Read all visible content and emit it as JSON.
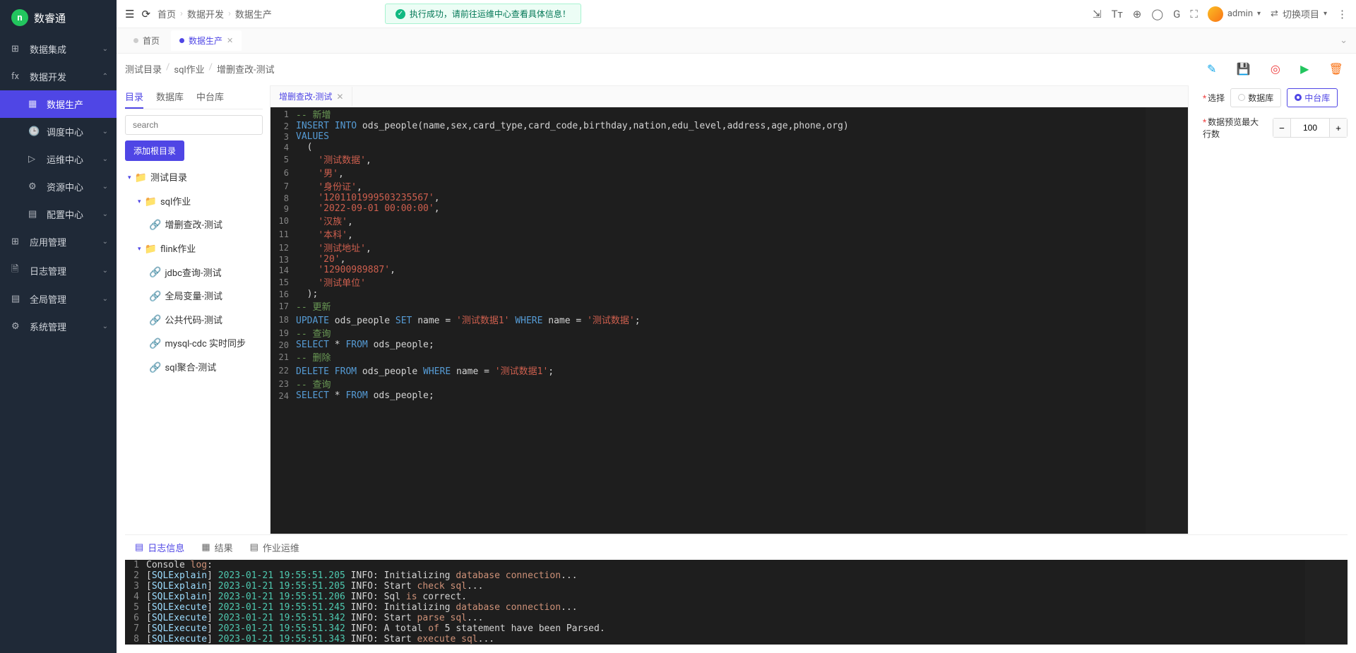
{
  "app": {
    "name": "数睿通",
    "logo_text": "n"
  },
  "sidebar": {
    "items": [
      {
        "icon": "⊞",
        "label": "数据集成",
        "chev": "⌄"
      },
      {
        "icon": "fx",
        "label": "数据开发",
        "chev": "⌃",
        "expanded": true,
        "children": [
          {
            "icon": "▦",
            "label": "数据生产",
            "active": true
          },
          {
            "icon": "🕒",
            "label": "调度中心",
            "chev": "⌄"
          },
          {
            "icon": "▷",
            "label": "运维中心",
            "chev": "⌄"
          },
          {
            "icon": "⚙",
            "label": "资源中心",
            "chev": "⌄"
          },
          {
            "icon": "▤",
            "label": "配置中心",
            "chev": "⌄"
          }
        ]
      },
      {
        "icon": "⊞",
        "label": "应用管理",
        "chev": "⌄"
      },
      {
        "icon": "🗎",
        "label": "日志管理",
        "chev": "⌄"
      },
      {
        "icon": "▤",
        "label": "全局管理",
        "chev": "⌄"
      },
      {
        "icon": "⚙",
        "label": "系统管理",
        "chev": "⌄"
      }
    ]
  },
  "topbar": {
    "crumbs": [
      "首页",
      "数据开发",
      "数据生产"
    ],
    "banner": "执行成功，请前往运维中心查看具体信息！",
    "user": "admin",
    "switch": "切换项目"
  },
  "pagetabs": [
    {
      "label": "首页",
      "active": false
    },
    {
      "label": "数据生产",
      "active": true
    }
  ],
  "breadcrumb2": [
    "测试目录",
    "sql作业",
    "增删查改-测试"
  ],
  "panel_tabs": [
    "目录",
    "数据库",
    "中台库"
  ],
  "search_placeholder": "search",
  "add_root_btn": "添加根目录",
  "tree": [
    {
      "d": 0,
      "caret": "▾",
      "type": "folder",
      "label": "测试目录"
    },
    {
      "d": 1,
      "caret": "▾",
      "type": "folder",
      "label": "sql作业"
    },
    {
      "d": 2,
      "type": "file",
      "label": "增删查改-测试"
    },
    {
      "d": 1,
      "caret": "▾",
      "type": "folder",
      "label": "flink作业"
    },
    {
      "d": 2,
      "type": "file",
      "label": "jdbc查询-测试"
    },
    {
      "d": 2,
      "type": "file",
      "label": "全局变量-测试"
    },
    {
      "d": 2,
      "type": "file",
      "label": "公共代码-测试"
    },
    {
      "d": 2,
      "type": "file",
      "label": "mysql-cdc 实时同步"
    },
    {
      "d": 2,
      "type": "file",
      "label": "sql聚合-测试"
    }
  ],
  "file_tab": "增删查改-测试",
  "editor_lines": [
    {
      "n": 1,
      "h": "<span class='c-comment'>-- 新增</span>"
    },
    {
      "n": 2,
      "h": "<span class='c-keyword'>INSERT</span> <span class='c-keyword'>INTO</span> ods_people(name,sex,card_type,card_code,birthday,nation,edu_level,address,age,phone,org)"
    },
    {
      "n": 3,
      "h": "<span class='c-keyword'>VALUES</span>"
    },
    {
      "n": 4,
      "h": "  ("
    },
    {
      "n": 5,
      "h": "    <span class='c-string'>'测试数据'</span>,"
    },
    {
      "n": 6,
      "h": "    <span class='c-string'>'男'</span>,"
    },
    {
      "n": 7,
      "h": "    <span class='c-string'>'身份证'</span>,"
    },
    {
      "n": 8,
      "h": "    <span class='c-string'>'1201101999503235567'</span>,"
    },
    {
      "n": 9,
      "h": "    <span class='c-string'>'2022-09-01 00:00:00'</span>,"
    },
    {
      "n": 10,
      "h": "    <span class='c-string'>'汉族'</span>,"
    },
    {
      "n": 11,
      "h": "    <span class='c-string'>'本科'</span>,"
    },
    {
      "n": 12,
      "h": "    <span class='c-string'>'测试地址'</span>,"
    },
    {
      "n": 13,
      "h": "    <span class='c-string'>'20'</span>,"
    },
    {
      "n": 14,
      "h": "    <span class='c-string'>'12900989887'</span>,"
    },
    {
      "n": 15,
      "h": "    <span class='c-string'>'测试单位'</span>"
    },
    {
      "n": 16,
      "h": "  );"
    },
    {
      "n": 17,
      "h": "<span class='c-comment'>-- 更新</span>"
    },
    {
      "n": 18,
      "h": "<span class='c-keyword'>UPDATE</span> ods_people <span class='c-keyword'>SET</span> name = <span class='c-string'>'测试数据1'</span> <span class='c-keyword'>WHERE</span> name = <span class='c-string'>'测试数据'</span>;"
    },
    {
      "n": 19,
      "h": "<span class='c-comment'>-- 查询</span>"
    },
    {
      "n": 20,
      "h": "<span class='c-keyword'>SELECT</span> * <span class='c-keyword'>FROM</span> ods_people;"
    },
    {
      "n": 21,
      "h": "<span class='c-comment'>-- 删除</span>"
    },
    {
      "n": 22,
      "h": "<span class='c-keyword'>DELETE</span> <span class='c-keyword'>FROM</span> ods_people <span class='c-keyword'>WHERE</span> name = <span class='c-string'>'测试数据1'</span>;"
    },
    {
      "n": 23,
      "h": "<span class='c-comment'>-- 查询</span>"
    },
    {
      "n": 24,
      "h": "<span class='c-keyword'>SELECT</span> * <span class='c-keyword'>FROM</span> ods_people;"
    }
  ],
  "right": {
    "select_label": "选择",
    "opt1": "数据库",
    "opt2": "中台库",
    "max_rows_label": "数据预览最大行数",
    "max_rows_value": "100"
  },
  "bottom_tabs": [
    "日志信息",
    "结果",
    "作业运维"
  ],
  "console_lines": [
    {
      "n": 1,
      "h": "Console <span class='c-hl'>log</span>:"
    },
    {
      "n": 2,
      "h": "[<span class='c-tag'>SQLExplain</span>] <span class='c-ts'>2023-01-21 19:55:51.205</span> INFO: Initializing <span class='c-hl'>database connection</span>..."
    },
    {
      "n": 3,
      "h": "[<span class='c-tag'>SQLExplain</span>] <span class='c-ts'>2023-01-21 19:55:51.205</span> INFO: Start <span class='c-hl'>check sql</span>..."
    },
    {
      "n": 4,
      "h": "[<span class='c-tag'>SQLExplain</span>] <span class='c-ts'>2023-01-21 19:55:51.206</span> INFO: Sql <span class='c-hl'>is</span> correct."
    },
    {
      "n": 5,
      "h": "[<span class='c-tag'>SQLExecute</span>] <span class='c-ts'>2023-01-21 19:55:51.245</span> INFO: Initializing <span class='c-hl'>database connection</span>..."
    },
    {
      "n": 6,
      "h": "[<span class='c-tag'>SQLExecute</span>] <span class='c-ts'>2023-01-21 19:55:51.342</span> INFO: Start <span class='c-hl'>parse sql</span>..."
    },
    {
      "n": 7,
      "h": "[<span class='c-tag'>SQLExecute</span>] <span class='c-ts'>2023-01-21 19:55:51.342</span> INFO: A total <span class='c-hl'>of</span> 5 statement have been Parsed."
    },
    {
      "n": 8,
      "h": "[<span class='c-tag'>SQLExecute</span>] <span class='c-ts'>2023-01-21 19:55:51.343</span> INFO: Start <span class='c-hl'>execute sql</span>..."
    }
  ]
}
